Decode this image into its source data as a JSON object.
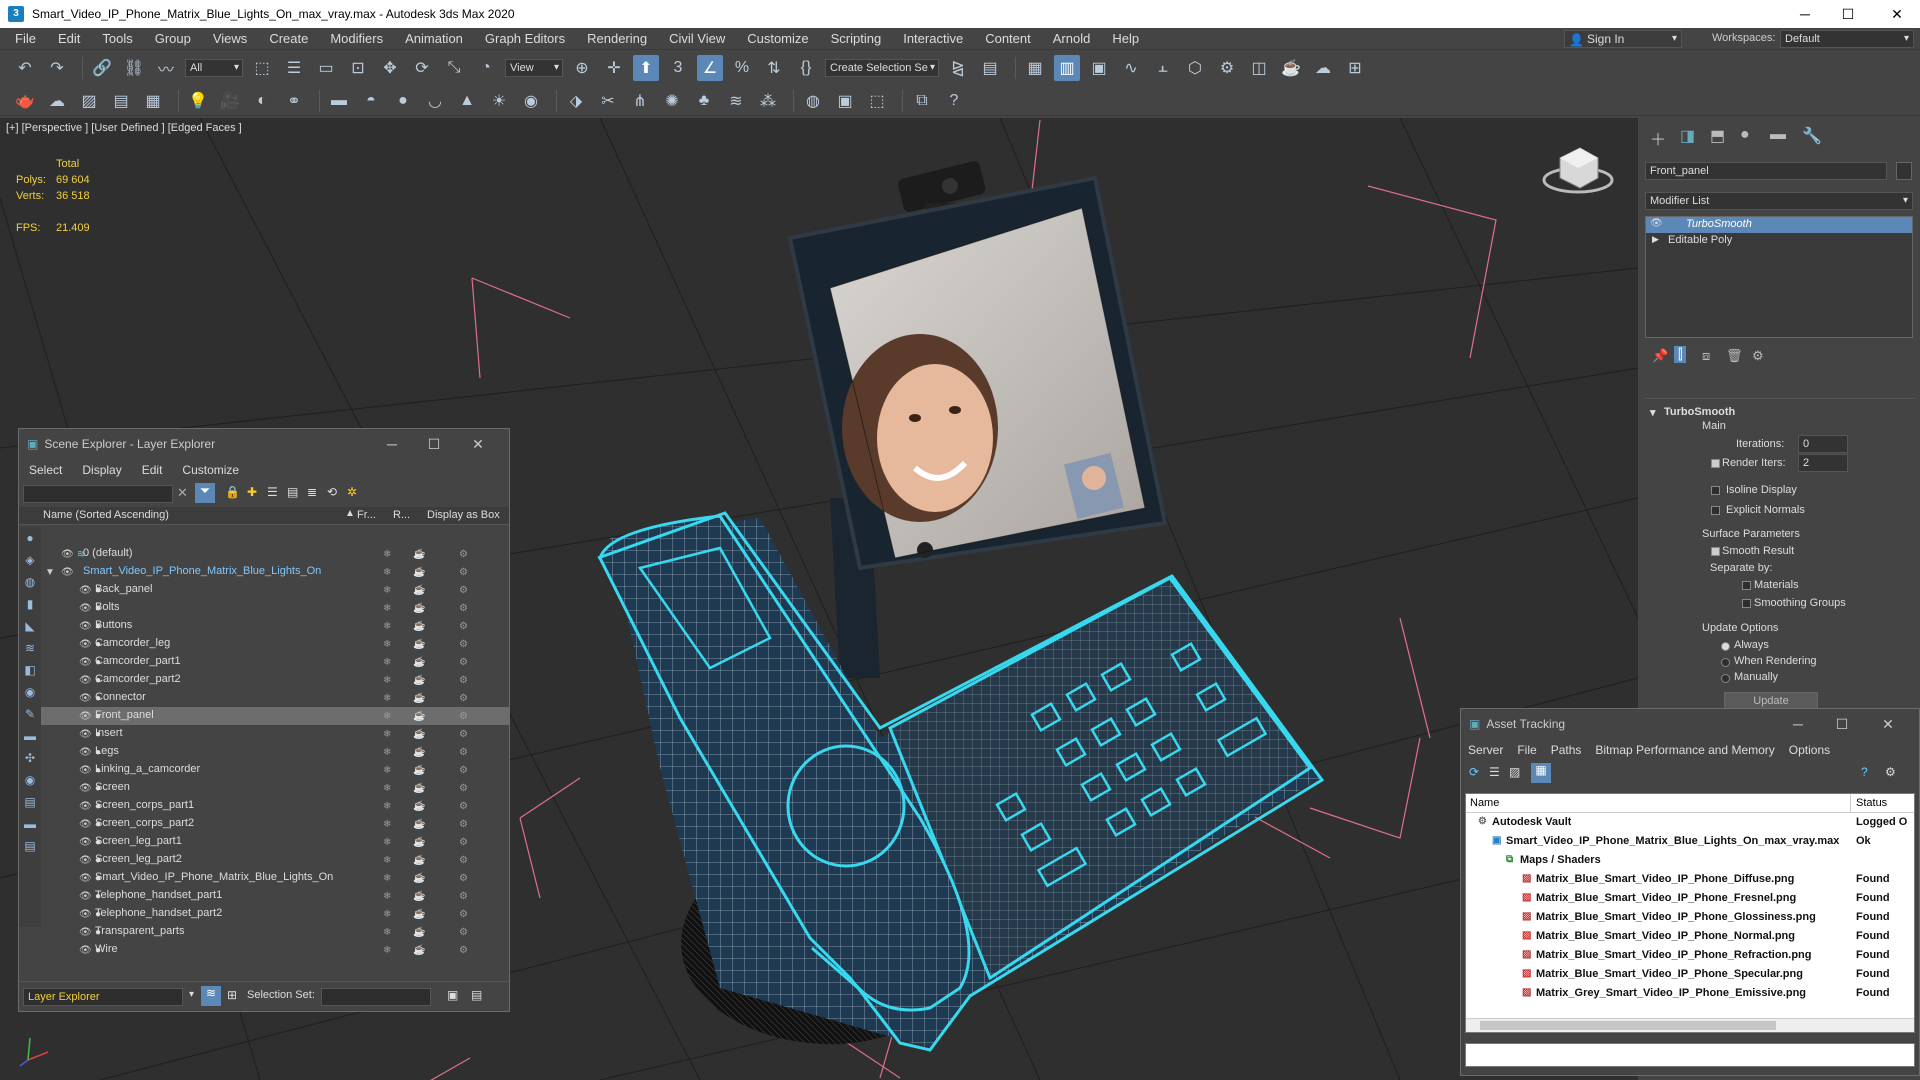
{
  "title": "Smart_Video_IP_Phone_Matrix_Blue_Lights_On_max_vray.max - Autodesk 3ds Max 2020",
  "window_controls": {
    "minimize": "─",
    "maximize": "☐",
    "close": "✕"
  },
  "menu": [
    "File",
    "Edit",
    "Tools",
    "Group",
    "Views",
    "Create",
    "Modifiers",
    "Animation",
    "Graph Editors",
    "Rendering",
    "Civil View",
    "Customize",
    "Scripting",
    "Interactive",
    "Content",
    "Arnold",
    "Help"
  ],
  "signin": "Sign In",
  "workspaces_label": "Workspaces:",
  "workspace": "Default",
  "toolbar": {
    "filter": "All",
    "refcoord": "View",
    "selection_set": "Create Selection Se"
  },
  "viewport": {
    "label": "[+] [Perspective ] [User Defined ] [Edged Faces ]",
    "stats_header": "Total",
    "polys_label": "Polys:",
    "polys": "69 604",
    "verts_label": "Verts:",
    "verts": "36 518",
    "fps_label": "FPS:",
    "fps": "21.409"
  },
  "command_panel": {
    "object_name": "Front_panel",
    "modifier_list": "Modifier List",
    "stack": [
      {
        "label": "TurboSmooth",
        "selected": true
      },
      {
        "label": "Editable Poly",
        "selected": false
      }
    ],
    "rollout_title": "TurboSmooth",
    "main_label": "Main",
    "iterations_label": "Iterations:",
    "iterations": "0",
    "render_iters_label": "Render Iters:",
    "render_iters": "2",
    "isoline": "Isoline Display",
    "explicit_normals": "Explicit Normals",
    "surface_params": "Surface Parameters",
    "smooth_result": "Smooth Result",
    "separate_by": "Separate by:",
    "materials": "Materials",
    "smoothing_groups": "Smoothing Groups",
    "update_options": "Update Options",
    "always": "Always",
    "when_rendering": "When Rendering",
    "manually": "Manually",
    "update_button": "Update"
  },
  "scene_explorer": {
    "title": "Scene Explorer - Layer Explorer",
    "menu": [
      "Select",
      "Display",
      "Edit",
      "Customize"
    ],
    "columns": [
      "Name (Sorted Ascending)",
      "Fr...",
      "R...",
      "Display as Box"
    ],
    "rows": [
      {
        "name": "0 (default)",
        "level": 0,
        "parent": false,
        "selected": false
      },
      {
        "name": "Smart_Video_IP_Phone_Matrix_Blue_Lights_On",
        "level": 0,
        "parent": true,
        "selected": false
      },
      {
        "name": "Back_panel",
        "level": 1,
        "selected": false
      },
      {
        "name": "Bolts",
        "level": 1,
        "selected": false
      },
      {
        "name": "Buttons",
        "level": 1,
        "selected": false
      },
      {
        "name": "Camcorder_leg",
        "level": 1,
        "selected": false
      },
      {
        "name": "Camcorder_part1",
        "level": 1,
        "selected": false
      },
      {
        "name": "Camcorder_part2",
        "level": 1,
        "selected": false
      },
      {
        "name": "Connector",
        "level": 1,
        "selected": false
      },
      {
        "name": "Front_panel",
        "level": 1,
        "selected": true
      },
      {
        "name": "Insert",
        "level": 1,
        "selected": false
      },
      {
        "name": "Legs",
        "level": 1,
        "selected": false
      },
      {
        "name": "Linking_a_camcorder",
        "level": 1,
        "selected": false
      },
      {
        "name": "Screen",
        "level": 1,
        "selected": false
      },
      {
        "name": "Screen_corps_part1",
        "level": 1,
        "selected": false
      },
      {
        "name": "Screen_corps_part2",
        "level": 1,
        "selected": false
      },
      {
        "name": "Screen_leg_part1",
        "level": 1,
        "selected": false
      },
      {
        "name": "Screen_leg_part2",
        "level": 1,
        "selected": false
      },
      {
        "name": "Smart_Video_IP_Phone_Matrix_Blue_Lights_On",
        "level": 1,
        "selected": false
      },
      {
        "name": "Telephone_handset_part1",
        "level": 1,
        "selected": false
      },
      {
        "name": "Telephone_handset_part2",
        "level": 1,
        "selected": false
      },
      {
        "name": "Transparent_parts",
        "level": 1,
        "selected": false
      },
      {
        "name": "Wire",
        "level": 1,
        "selected": false
      }
    ],
    "footer_explorer": "Layer Explorer",
    "footer_selset": "Selection Set:"
  },
  "asset_tracking": {
    "title": "Asset Tracking",
    "menu": [
      "Server",
      "File",
      "Paths",
      "Bitmap Performance and Memory",
      "Options"
    ],
    "columns": [
      "Name",
      "Status"
    ],
    "rows": [
      {
        "name": "Autodesk Vault",
        "status": "Logged O",
        "level": 0,
        "bold": true
      },
      {
        "name": "Smart_Video_IP_Phone_Matrix_Blue_Lights_On_max_vray.max",
        "status": "Ok",
        "level": 1,
        "bold": true
      },
      {
        "name": "Maps / Shaders",
        "status": "",
        "level": 2,
        "bold": true
      },
      {
        "name": "Matrix_Blue_Smart_Video_IP_Phone_Diffuse.png",
        "status": "Found",
        "level": 3,
        "bold": true
      },
      {
        "name": "Matrix_Blue_Smart_Video_IP_Phone_Fresnel.png",
        "status": "Found",
        "level": 3,
        "bold": true
      },
      {
        "name": "Matrix_Blue_Smart_Video_IP_Phone_Glossiness.png",
        "status": "Found",
        "level": 3,
        "bold": true
      },
      {
        "name": "Matrix_Blue_Smart_Video_IP_Phone_Normal.png",
        "status": "Found",
        "level": 3,
        "bold": true
      },
      {
        "name": "Matrix_Blue_Smart_Video_IP_Phone_Refraction.png",
        "status": "Found",
        "level": 3,
        "bold": true
      },
      {
        "name": "Matrix_Blue_Smart_Video_IP_Phone_Specular.png",
        "status": "Found",
        "level": 3,
        "bold": true
      },
      {
        "name": "Matrix_Grey_Smart_Video_IP_Phone_Emissive.png",
        "status": "Found",
        "level": 3,
        "bold": true
      }
    ]
  },
  "colors": {
    "selection_cyan": "#38d8ee",
    "bbox_pink": "#e0708a",
    "stats_yellow": "#f0d040",
    "accent_blue": "#5b88b6"
  }
}
